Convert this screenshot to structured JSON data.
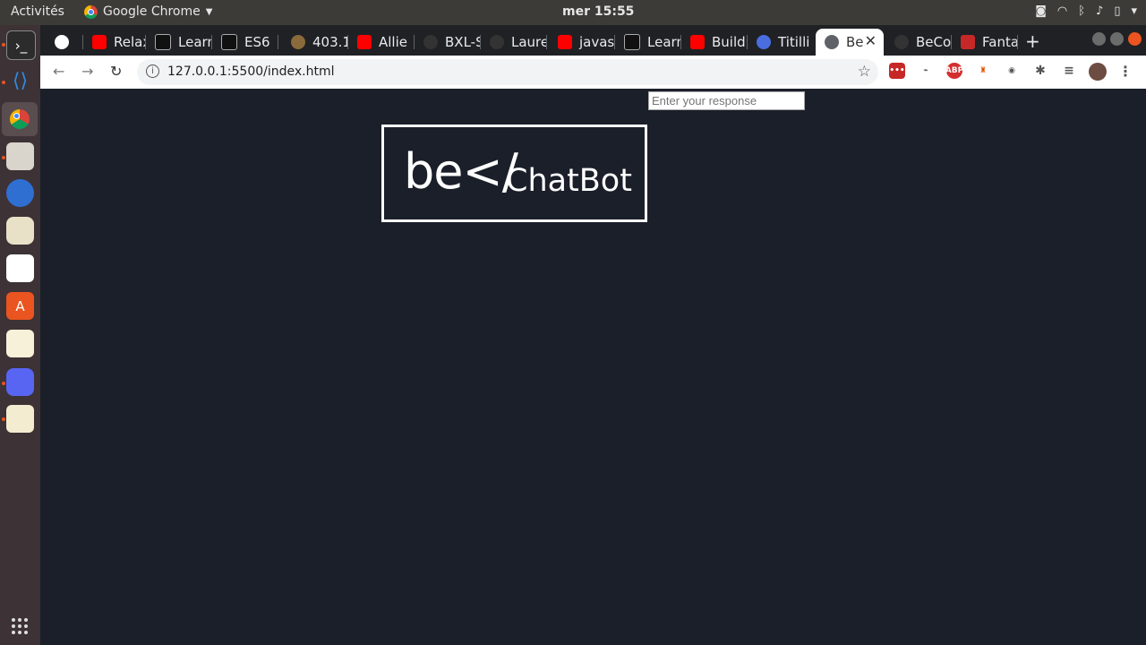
{
  "topbar": {
    "activities": "Activités",
    "app_name": "Google Chrome",
    "clock": "mer 15:55"
  },
  "browser": {
    "tabs": [
      {
        "label": "",
        "icon": "owl-icon"
      },
      {
        "label": "Relax",
        "icon": "youtube-icon"
      },
      {
        "label": "Learn",
        "icon": "course-icon"
      },
      {
        "label": "ES6",
        "icon": "course-icon"
      },
      {
        "label": "403.1",
        "icon": "badge-icon"
      },
      {
        "label": "Allie",
        "icon": "youtube-icon"
      },
      {
        "label": "BXL-S",
        "icon": "github-icon"
      },
      {
        "label": "Laure",
        "icon": "github-icon"
      },
      {
        "label": "javas",
        "icon": "youtube-icon"
      },
      {
        "label": "Learn",
        "icon": "course-icon"
      },
      {
        "label": "Build",
        "icon": "youtube-icon"
      },
      {
        "label": "Titilli",
        "icon": "f-icon"
      },
      {
        "label": "Be",
        "icon": "globe-icon",
        "active": true
      },
      {
        "label": "BeCo",
        "icon": "circle-icon"
      },
      {
        "label": "Fanta",
        "icon": "bookmark-icon"
      }
    ],
    "url": "127.0.0.1:5500/index.html",
    "extensions": [
      "lastpass",
      "shortcut",
      "ABP",
      "user",
      "monitor"
    ]
  },
  "page": {
    "input_placeholder": "Enter your response",
    "logo_be": "be</",
    "logo_chatbot": "ChatBot"
  }
}
